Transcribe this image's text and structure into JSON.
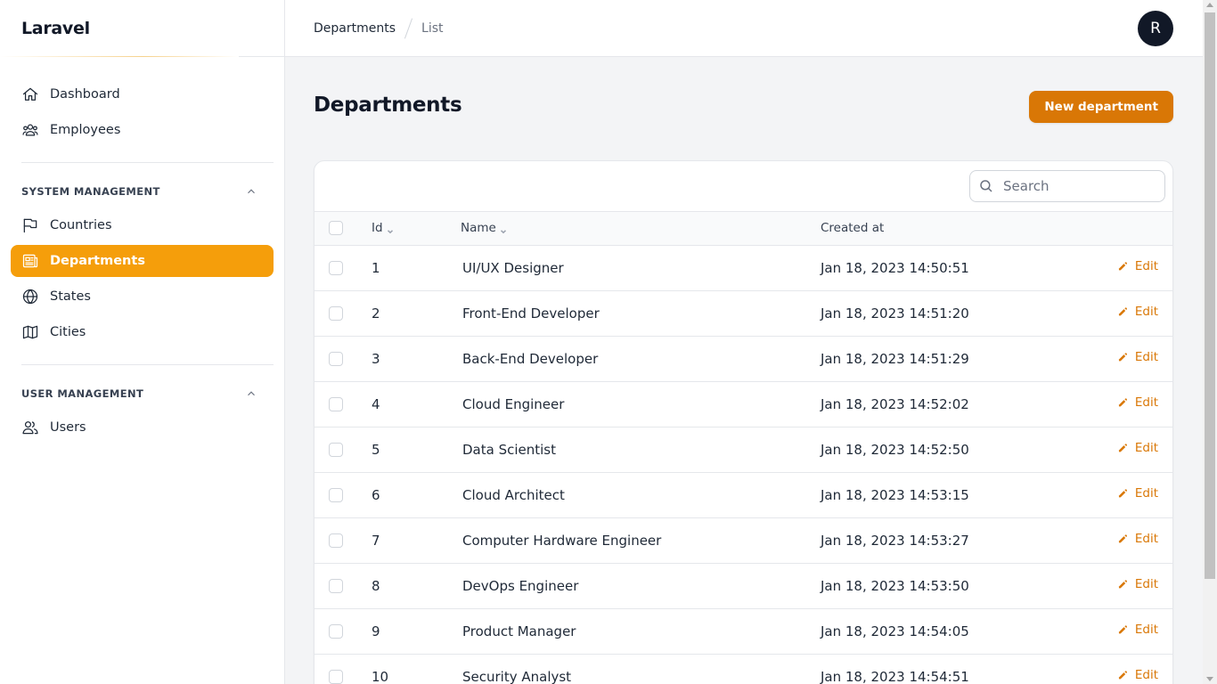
{
  "app": {
    "brand": "Laravel"
  },
  "sidebar": {
    "items": [
      {
        "label": "Dashboard",
        "icon": "home-icon"
      },
      {
        "label": "Employees",
        "icon": "users-group-icon"
      }
    ],
    "groups": [
      {
        "title": "SYSTEM MANAGEMENT",
        "items": [
          {
            "label": "Countries",
            "icon": "flag-icon"
          },
          {
            "label": "Departments",
            "icon": "newspaper-icon",
            "active": true
          },
          {
            "label": "States",
            "icon": "globe-icon"
          },
          {
            "label": "Cities",
            "icon": "map-icon"
          }
        ]
      },
      {
        "title": "USER MANAGEMENT",
        "items": [
          {
            "label": "Users",
            "icon": "user-group-icon"
          }
        ]
      }
    ]
  },
  "topbar": {
    "breadcrumb": [
      "Departments",
      "List"
    ],
    "avatar_initial": "R"
  },
  "page": {
    "title": "Departments",
    "new_button": "New department"
  },
  "table": {
    "search_placeholder": "Search",
    "columns": [
      "Id",
      "Name",
      "Created at"
    ],
    "edit_label": "Edit",
    "rows": [
      {
        "id": "1",
        "name": "UI/UX Designer",
        "created_at": "Jan 18, 2023 14:50:51"
      },
      {
        "id": "2",
        "name": "Front-End Developer",
        "created_at": "Jan 18, 2023 14:51:20"
      },
      {
        "id": "3",
        "name": "Back-End Developer",
        "created_at": "Jan 18, 2023 14:51:29"
      },
      {
        "id": "4",
        "name": "Cloud Engineer",
        "created_at": "Jan 18, 2023 14:52:02"
      },
      {
        "id": "5",
        "name": "Data Scientist",
        "created_at": "Jan 18, 2023 14:52:50"
      },
      {
        "id": "6",
        "name": "Cloud Architect",
        "created_at": "Jan 18, 2023 14:53:15"
      },
      {
        "id": "7",
        "name": "Computer Hardware Engineer",
        "created_at": "Jan 18, 2023 14:53:27"
      },
      {
        "id": "8",
        "name": "DevOps Engineer",
        "created_at": "Jan 18, 2023 14:53:50"
      },
      {
        "id": "9",
        "name": "Product Manager",
        "created_at": "Jan 18, 2023 14:54:05"
      },
      {
        "id": "10",
        "name": "Security Analyst",
        "created_at": "Jan 18, 2023 14:54:51"
      }
    ]
  },
  "colors": {
    "accent": "#f59e0b",
    "primary_button": "#d97706",
    "edit_link": "#d97706",
    "avatar_bg": "#111827"
  }
}
